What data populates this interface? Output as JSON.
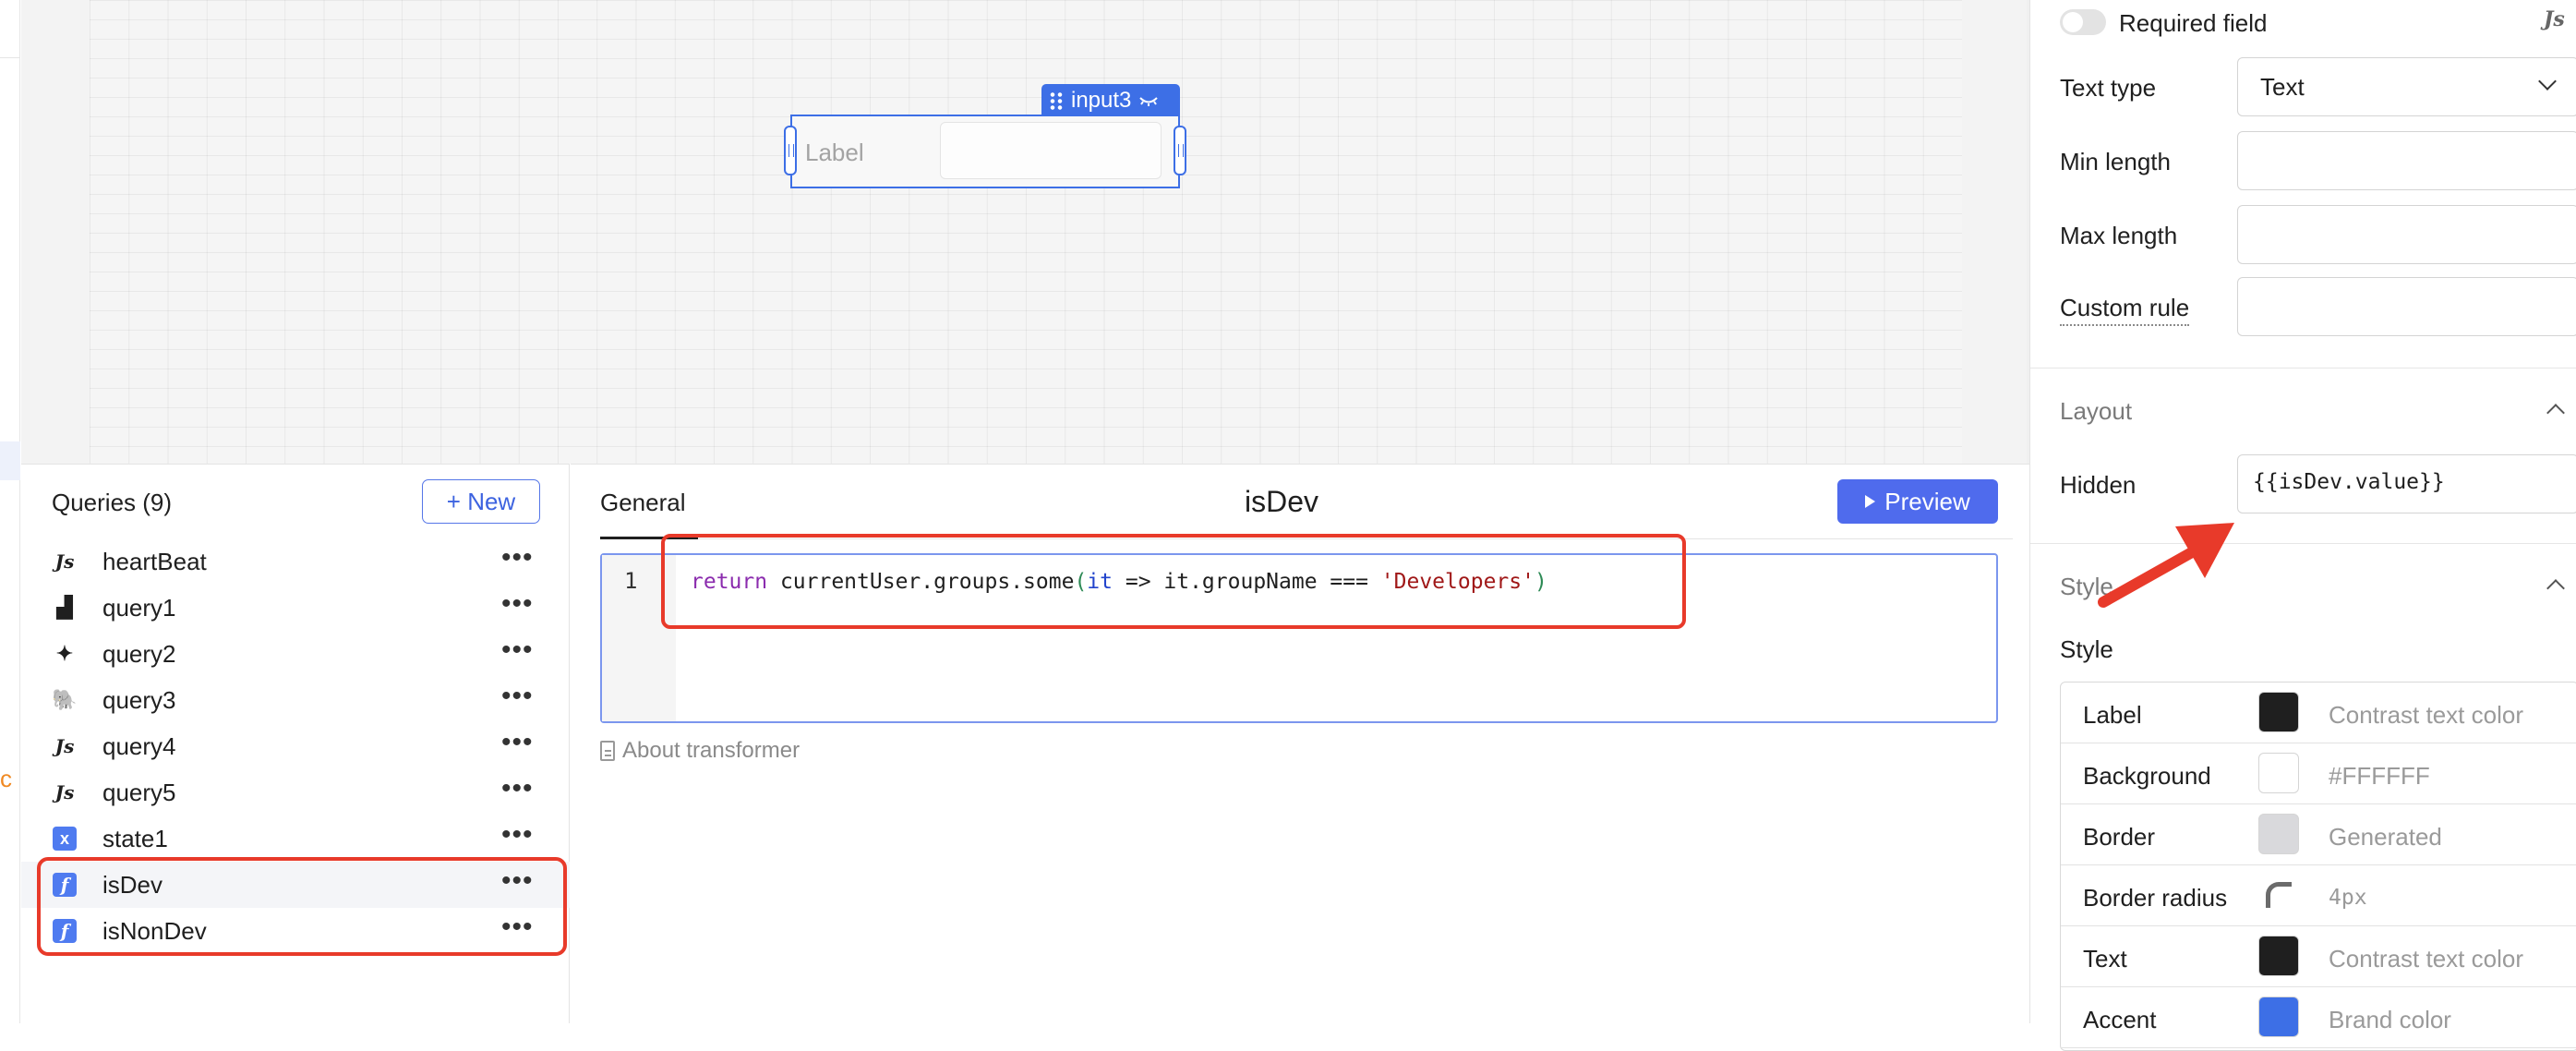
{
  "widget": {
    "name": "input3",
    "label": "Label"
  },
  "queries": {
    "title": "Queries (9)",
    "new_label": "+ New",
    "items": [
      {
        "name": "heartBeat",
        "icon": "js-icon",
        "glyph": "Js"
      },
      {
        "name": "query1",
        "icon": "grid-icon",
        "glyph": "▟"
      },
      {
        "name": "query2",
        "icon": "rocket-icon",
        "glyph": "✦"
      },
      {
        "name": "query3",
        "icon": "elephant-icon",
        "glyph": "🐘"
      },
      {
        "name": "query4",
        "icon": "js-icon",
        "glyph": "Js"
      },
      {
        "name": "query5",
        "icon": "js-icon",
        "glyph": "Js"
      },
      {
        "name": "state1",
        "icon": "state-icon",
        "glyph": "x"
      },
      {
        "name": "isDev",
        "icon": "function-icon",
        "glyph": "f"
      },
      {
        "name": "isNonDev",
        "icon": "function-icon",
        "glyph": "f"
      }
    ],
    "more_glyph": "•••"
  },
  "editor": {
    "tab": "General",
    "title": "isDev",
    "preview_label": "Preview",
    "line_number": "1",
    "code": {
      "kw": "return",
      "a": " currentUser.groups.some",
      "p1": "(",
      "it1": "it",
      "b": " => it.groupName === ",
      "str": "'Developers'",
      "p2": ")"
    },
    "about": "About transformer"
  },
  "inspector": {
    "required_label": "Required field",
    "js_mark": "Js",
    "text_type_label": "Text type",
    "text_type_value": "Text",
    "min_length_label": "Min length",
    "max_length_label": "Max length",
    "custom_rule_label": "Custom rule",
    "layout_title": "Layout",
    "hidden_label": "Hidden",
    "hidden_value": "{{isDev.value}}",
    "style_section_title": "Style",
    "style_label": "Style",
    "style_rows": [
      {
        "label": "Label",
        "value": "Contrast text color",
        "color": "#1f1f1f"
      },
      {
        "label": "Background",
        "value": "#FFFFFF",
        "color": "#ffffff"
      },
      {
        "label": "Border",
        "value": "Generated",
        "color": "#d9d9dc"
      },
      {
        "label": "Border radius",
        "value": "4px",
        "color": ""
      },
      {
        "label": "Text",
        "value": "Contrast text color",
        "color": "#1f1f1f"
      },
      {
        "label": "Accent",
        "value": "Brand color",
        "color": "#3d6fe6"
      }
    ]
  },
  "left_strip": {
    "mark": "c"
  },
  "colors": {
    "accent": "#3d6fe6",
    "annotation": "#e83a2a"
  }
}
